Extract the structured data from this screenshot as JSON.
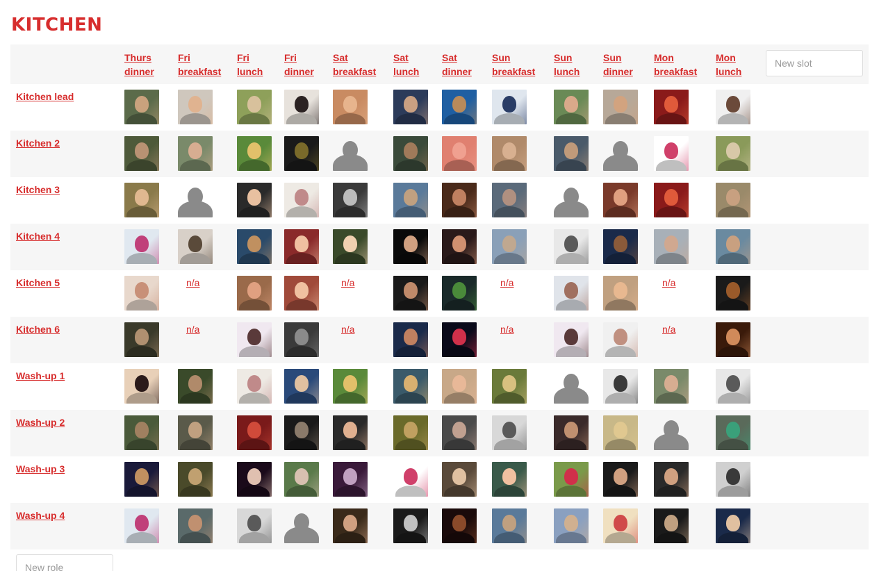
{
  "page": {
    "title": "KITCHEN"
  },
  "new_slot_placeholder": "New slot",
  "new_role_placeholder": "New role",
  "columns": [
    [
      "Thurs",
      "dinner"
    ],
    [
      "Fri",
      "breakfast"
    ],
    [
      "Fri",
      "lunch"
    ],
    [
      "Fri",
      "dinner"
    ],
    [
      "Sat",
      "breakfast"
    ],
    [
      "Sat",
      "lunch"
    ],
    [
      "Sat",
      "dinner"
    ],
    [
      "Sun",
      "breakfast"
    ],
    [
      "Sun",
      "lunch"
    ],
    [
      "Sun",
      "dinner"
    ],
    [
      "Mon",
      "breakfast"
    ],
    [
      "Mon",
      "lunch"
    ]
  ],
  "roles": [
    {
      "label": "Kitchen lead",
      "cells": [
        {
          "t": "photo",
          "c": [
            "#5b6b4a",
            "#c9a27d"
          ]
        },
        {
          "t": "photo",
          "c": [
            "#cfc7bd",
            "#e0b390"
          ]
        },
        {
          "t": "photo",
          "c": [
            "#8ea05a",
            "#d8c19c"
          ]
        },
        {
          "t": "photo",
          "c": [
            "#e7e2dc",
            "#2b2222"
          ]
        },
        {
          "t": "photo",
          "c": [
            "#c98b62",
            "#e7b48d"
          ]
        },
        {
          "t": "photo",
          "c": [
            "#2c3b5a",
            "#caa082"
          ]
        },
        {
          "t": "photo",
          "c": [
            "#1f5fa2",
            "#b88a5b"
          ]
        },
        {
          "t": "photo",
          "c": [
            "#dfe6ee",
            "#2a3d66"
          ]
        },
        {
          "t": "photo",
          "c": [
            "#6a8a56",
            "#d9a98a"
          ]
        },
        {
          "t": "photo",
          "c": [
            "#b7a898",
            "#d2a37f"
          ]
        },
        {
          "t": "photo",
          "c": [
            "#8a1a1a",
            "#e05a3a"
          ]
        },
        {
          "t": "photo",
          "c": [
            "#f0f0f0",
            "#6b4a3a"
          ]
        }
      ]
    },
    {
      "label": "Kitchen 2",
      "cells": [
        {
          "t": "photo",
          "c": [
            "#4e5a3a",
            "#b99273"
          ]
        },
        {
          "t": "photo",
          "c": [
            "#7a8a6a",
            "#d7ad91"
          ]
        },
        {
          "t": "photo",
          "c": [
            "#5a8a3a",
            "#e2c06a"
          ]
        },
        {
          "t": "photo",
          "c": [
            "#1a1a1a",
            "#7a6a2a"
          ]
        },
        {
          "t": "placeholder"
        },
        {
          "t": "photo",
          "c": [
            "#3a4a3a",
            "#a07a5a"
          ]
        },
        {
          "t": "photo",
          "c": [
            "#e08070",
            "#f0a090"
          ]
        },
        {
          "t": "photo",
          "c": [
            "#b08a6a",
            "#d8b090"
          ]
        },
        {
          "t": "photo",
          "c": [
            "#4a5a6a",
            "#c09a7a"
          ]
        },
        {
          "t": "placeholder"
        },
        {
          "t": "photo",
          "c": [
            "#ffffff",
            "#d0406a"
          ]
        },
        {
          "t": "photo",
          "c": [
            "#8a9a5a",
            "#d8c8a8"
          ]
        }
      ]
    },
    {
      "label": "Kitchen 3",
      "cells": [
        {
          "t": "photo",
          "c": [
            "#8a7a4a",
            "#e0b890"
          ]
        },
        {
          "t": "placeholder"
        },
        {
          "t": "photo",
          "c": [
            "#2a2a2a",
            "#e8c0a0"
          ]
        },
        {
          "t": "photo",
          "c": [
            "#eeeae4",
            "#c08a8a"
          ]
        },
        {
          "t": "photo",
          "c": [
            "#3a3a3a",
            "#bcbcbc"
          ]
        },
        {
          "t": "photo",
          "c": [
            "#5a7a9a",
            "#c0a080"
          ]
        },
        {
          "t": "photo",
          "c": [
            "#4a2a1a",
            "#c08060"
          ]
        },
        {
          "t": "photo",
          "c": [
            "#5a6a7a",
            "#b09080"
          ]
        },
        {
          "t": "placeholder"
        },
        {
          "t": "photo",
          "c": [
            "#7a3a2a",
            "#e0a080"
          ]
        },
        {
          "t": "photo",
          "c": [
            "#8a1a1a",
            "#e05a3a"
          ]
        },
        {
          "t": "photo",
          "c": [
            "#9a8a6a",
            "#c8a080"
          ]
        }
      ]
    },
    {
      "label": "Kitchen 4",
      "cells": [
        {
          "t": "photo",
          "c": [
            "#e0e8f0",
            "#c0407a"
          ]
        },
        {
          "t": "photo",
          "c": [
            "#d8d0c8",
            "#5a4a3a"
          ]
        },
        {
          "t": "photo",
          "c": [
            "#2a4a6a",
            "#c09060"
          ]
        },
        {
          "t": "photo",
          "c": [
            "#8a2a2a",
            "#f0c0a0"
          ]
        },
        {
          "t": "photo",
          "c": [
            "#3a4a2a",
            "#f0d0b0"
          ]
        },
        {
          "t": "photo",
          "c": [
            "#0a0a0a",
            "#d0a080"
          ]
        },
        {
          "t": "photo",
          "c": [
            "#2a1a1a",
            "#d09070"
          ]
        },
        {
          "t": "photo",
          "c": [
            "#8aa0b8",
            "#c0a890"
          ]
        },
        {
          "t": "photo",
          "c": [
            "#e8e8e8",
            "#5a5a5a"
          ]
        },
        {
          "t": "photo",
          "c": [
            "#1a2a4a",
            "#8a5a3a"
          ]
        },
        {
          "t": "photo",
          "c": [
            "#a8b0b8",
            "#d0a890"
          ]
        },
        {
          "t": "photo",
          "c": [
            "#6a8aa0",
            "#c8a080"
          ]
        }
      ]
    },
    {
      "label": "Kitchen 5",
      "cells": [
        {
          "t": "photo",
          "c": [
            "#e8d8cc",
            "#c89078"
          ]
        },
        {
          "t": "na"
        },
        {
          "t": "photo",
          "c": [
            "#9a6a4a",
            "#e0a080"
          ]
        },
        {
          "t": "photo",
          "c": [
            "#a04a3a",
            "#f0c0a0"
          ]
        },
        {
          "t": "na"
        },
        {
          "t": "photo",
          "c": [
            "#1a1a1a",
            "#c08a6a"
          ]
        },
        {
          "t": "photo",
          "c": [
            "#1a2a2a",
            "#4a8a3a"
          ]
        },
        {
          "t": "na"
        },
        {
          "t": "photo",
          "c": [
            "#e0e4ea",
            "#a07060"
          ]
        },
        {
          "t": "photo",
          "c": [
            "#c0a080",
            "#e8b890"
          ]
        },
        {
          "t": "na"
        },
        {
          "t": "photo",
          "c": [
            "#1a1a1a",
            "#9a5a2a"
          ]
        }
      ]
    },
    {
      "label": "Kitchen 6",
      "cells": [
        {
          "t": "photo",
          "c": [
            "#3a3a2a",
            "#b09070"
          ]
        },
        {
          "t": "na"
        },
        {
          "t": "photo",
          "c": [
            "#f0e8f0",
            "#5a3a3a"
          ]
        },
        {
          "t": "photo",
          "c": [
            "#3a3a3a",
            "#8a8a8a"
          ]
        },
        {
          "t": "na"
        },
        {
          "t": "photo",
          "c": [
            "#1a2a4a",
            "#c08060"
          ]
        },
        {
          "t": "photo",
          "c": [
            "#0a0a1a",
            "#d0304a"
          ]
        },
        {
          "t": "na"
        },
        {
          "t": "photo",
          "c": [
            "#f0e8f0",
            "#5a3a3a"
          ]
        },
        {
          "t": "photo",
          "c": [
            "#f0f0f0",
            "#c09080"
          ]
        },
        {
          "t": "na"
        },
        {
          "t": "photo",
          "c": [
            "#3a1a0a",
            "#d08a5a"
          ]
        }
      ]
    },
    {
      "label": "Wash-up 1",
      "cells": [
        {
          "t": "photo",
          "c": [
            "#e8d0b8",
            "#2a1a1a"
          ]
        },
        {
          "t": "photo",
          "c": [
            "#3a4a2a",
            "#b08a6a"
          ]
        },
        {
          "t": "photo",
          "c": [
            "#eeeae4",
            "#c08a8a"
          ]
        },
        {
          "t": "photo",
          "c": [
            "#2a4a7a",
            "#e0c0a0"
          ]
        },
        {
          "t": "photo",
          "c": [
            "#5a8a3a",
            "#e2c06a"
          ]
        },
        {
          "t": "photo",
          "c": [
            "#3a5a6a",
            "#d8b070"
          ]
        },
        {
          "t": "photo",
          "c": [
            "#c8a888",
            "#e8b898"
          ]
        },
        {
          "t": "photo",
          "c": [
            "#6a7a3a",
            "#d8c080"
          ]
        },
        {
          "t": "placeholder"
        },
        {
          "t": "photo",
          "c": [
            "#e8e8e8",
            "#3a3a3a"
          ]
        },
        {
          "t": "photo",
          "c": [
            "#7a8a6a",
            "#d7ad91"
          ]
        },
        {
          "t": "photo",
          "c": [
            "#e8e8e8",
            "#5a5a5a"
          ]
        }
      ]
    },
    {
      "label": "Wash-up 2",
      "cells": [
        {
          "t": "photo",
          "c": [
            "#4a5a3a",
            "#a08060"
          ]
        },
        {
          "t": "photo",
          "c": [
            "#5a5a4a",
            "#c0a080"
          ]
        },
        {
          "t": "photo",
          "c": [
            "#7a1a1a",
            "#d04a3a"
          ]
        },
        {
          "t": "photo",
          "c": [
            "#1a1a1a",
            "#8a7a6a"
          ]
        },
        {
          "t": "photo",
          "c": [
            "#2a2a2a",
            "#e0b090"
          ]
        },
        {
          "t": "photo",
          "c": [
            "#6a6a2a",
            "#c0a060"
          ]
        },
        {
          "t": "photo",
          "c": [
            "#4a4a4a",
            "#c0a090"
          ]
        },
        {
          "t": "photo",
          "c": [
            "#d8d8d8",
            "#5a5a5a"
          ]
        },
        {
          "t": "photo",
          "c": [
            "#3a2a2a",
            "#c09070"
          ]
        },
        {
          "t": "photo",
          "c": [
            "#c8b888",
            "#e0c890"
          ]
        },
        {
          "t": "placeholder"
        },
        {
          "t": "photo",
          "c": [
            "#5a6a5a",
            "#3aa07a"
          ]
        }
      ]
    },
    {
      "label": "Wash-up 3",
      "cells": [
        {
          "t": "photo",
          "c": [
            "#1a1a3a",
            "#c09060"
          ]
        },
        {
          "t": "photo",
          "c": [
            "#4a4a2a",
            "#c0a070"
          ]
        },
        {
          "t": "photo",
          "c": [
            "#1a0a1a",
            "#e0c0b0"
          ]
        },
        {
          "t": "photo",
          "c": [
            "#5a7a4a",
            "#d8c0b0"
          ]
        },
        {
          "t": "photo",
          "c": [
            "#3a1a3a",
            "#c0a0c0"
          ]
        },
        {
          "t": "photo",
          "c": [
            "#ffffff",
            "#d0406a"
          ]
        },
        {
          "t": "photo",
          "c": [
            "#5a4a3a",
            "#e0c0a0"
          ]
        },
        {
          "t": "photo",
          "c": [
            "#3a5a4a",
            "#f0c0a0"
          ]
        },
        {
          "t": "photo",
          "c": [
            "#7a9a4a",
            "#d0304a"
          ]
        },
        {
          "t": "photo",
          "c": [
            "#1a1a1a",
            "#d0a080"
          ]
        },
        {
          "t": "photo",
          "c": [
            "#2a2a2a",
            "#d0a080"
          ]
        },
        {
          "t": "photo",
          "c": [
            "#d0d0d0",
            "#3a3a3a"
          ]
        }
      ]
    },
    {
      "label": "Wash-up 4",
      "cells": [
        {
          "t": "photo",
          "c": [
            "#e0e8f0",
            "#c0407a"
          ]
        },
        {
          "t": "photo",
          "c": [
            "#5a6a6a",
            "#c09070"
          ]
        },
        {
          "t": "photo",
          "c": [
            "#d8d8d8",
            "#5a5a5a"
          ]
        },
        {
          "t": "placeholder"
        },
        {
          "t": "photo",
          "c": [
            "#3a2a1a",
            "#d0a080"
          ]
        },
        {
          "t": "photo",
          "c": [
            "#1a1a1a",
            "#c0c0c0"
          ]
        },
        {
          "t": "photo",
          "c": [
            "#1a0a0a",
            "#8a4a2a"
          ]
        },
        {
          "t": "photo",
          "c": [
            "#5a7a9a",
            "#c0a080"
          ]
        },
        {
          "t": "photo",
          "c": [
            "#8aa0c0",
            "#d0b090"
          ]
        },
        {
          "t": "photo",
          "c": [
            "#f0e0c0",
            "#d04a4a"
          ]
        },
        {
          "t": "photo",
          "c": [
            "#1a1a1a",
            "#c0a080"
          ]
        },
        {
          "t": "photo",
          "c": [
            "#1a2a4a",
            "#e0c0a0"
          ]
        }
      ]
    }
  ],
  "na_text": "n/a",
  "colors": {
    "accent": "#d72d2d",
    "row_shade": "#f6f6f6",
    "placeholder_grey": "#8a8a8a"
  }
}
